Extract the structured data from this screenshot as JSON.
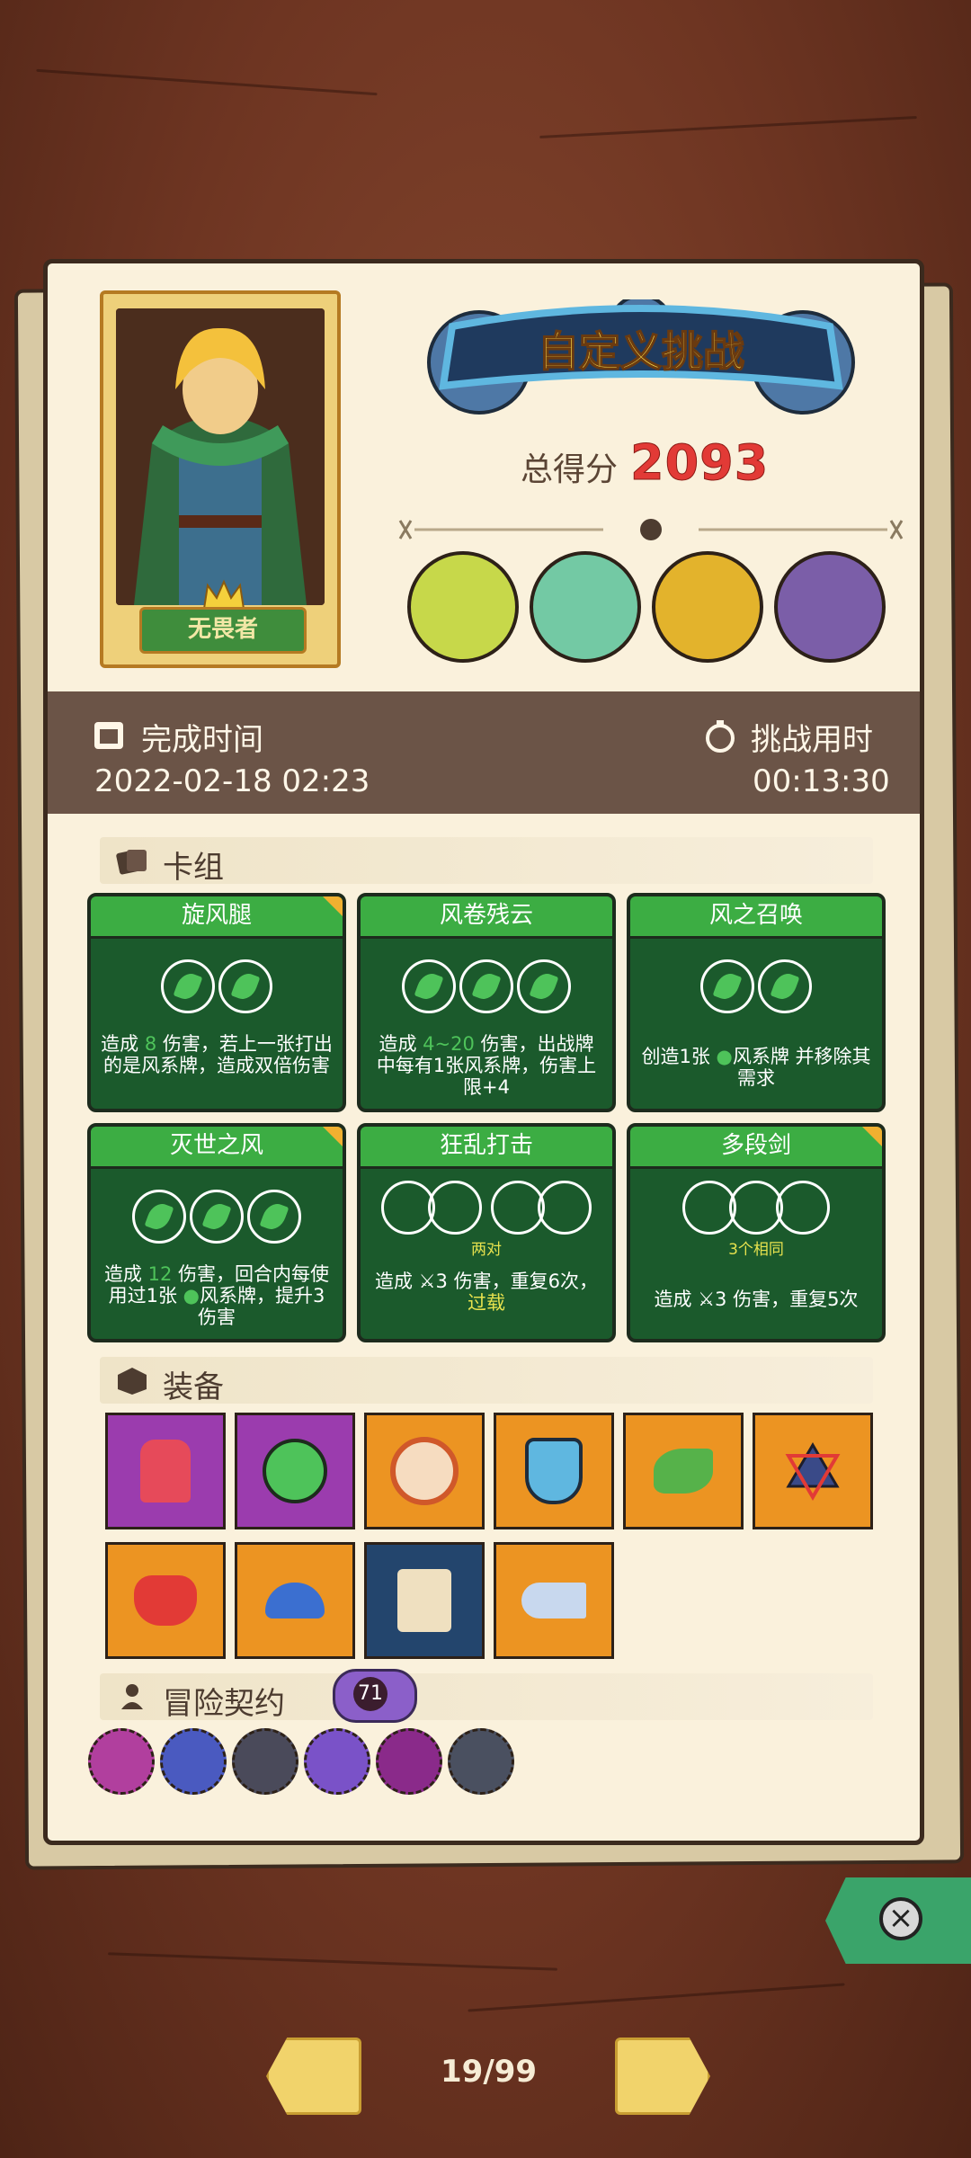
{
  "hero": {
    "name": "无畏者"
  },
  "title": "自定义挑战",
  "score": {
    "label": "总得分",
    "value": "2093"
  },
  "time": {
    "finish_label": "完成时间",
    "finish_value": "2022-02-18 02:23",
    "duration_label": "挑战用时",
    "duration_value": "00:13:30"
  },
  "deck": {
    "header": "卡组",
    "cards": [
      {
        "name": "旋风腿",
        "orbs": 2,
        "desc_a": "造成",
        "num": "8",
        "desc_b": "伤害，若上一张打出的是风系牌，造成双倍伤害"
      },
      {
        "name": "风卷残云",
        "orbs": 3,
        "desc_a": "造成",
        "num": "4~20",
        "desc_b": "伤害，出战牌中每有1张风系牌，伤害上限+4"
      },
      {
        "name": "风之召唤",
        "orbs": 2,
        "desc_a": "创造1张",
        "desc_b": "风系牌 并移除其需求"
      },
      {
        "name": "灭世之风",
        "orbs": 3,
        "desc_a": "造成",
        "num": "12",
        "desc_b": "伤害，回合内每使用过1张",
        "desc_c": "风系牌，提升3伤害"
      },
      {
        "name": "狂乱打击",
        "orbs_label": "两对",
        "desc_a": "造成",
        "num": "3",
        "desc_b": "伤害，重复6次，",
        "desc_c": "过载"
      },
      {
        "name": "多段剑",
        "orbs_label": "3个相同",
        "desc_a": "造成",
        "num": "3",
        "desc_b": "伤害，重复5次"
      }
    ]
  },
  "equipment": {
    "header": "装备",
    "items": [
      {
        "icon": "flesh-cloak-icon",
        "color": "#9b3cae"
      },
      {
        "icon": "green-gem-icon",
        "color": "#9b3cae"
      },
      {
        "icon": "eye-shield-icon",
        "color": "#ec9422"
      },
      {
        "icon": "skull-crest-icon",
        "color": "#ec9422"
      },
      {
        "icon": "green-creature-icon",
        "color": "#ec9422"
      },
      {
        "icon": "hexagram-icon",
        "color": "#ec9422"
      },
      {
        "icon": "demon-skull-icon",
        "color": "#ec9422"
      },
      {
        "icon": "mushroom-icon",
        "color": "#ec9422"
      },
      {
        "icon": "scroll-icon",
        "color": "#23456d"
      },
      {
        "icon": "horn-icon",
        "color": "#ec9422"
      }
    ]
  },
  "contract": {
    "header": "冒险契约",
    "level": "71",
    "icons": [
      "lamp-icon",
      "genie-icon",
      "axe-icon",
      "potion-icon",
      "rune-icon",
      "mystery-shield-icon"
    ]
  },
  "pager": {
    "text": "19/99"
  },
  "colors": {
    "leaf": "#4ec35a",
    "score": "#e23a36",
    "card_bg": "#1b5a2c"
  }
}
